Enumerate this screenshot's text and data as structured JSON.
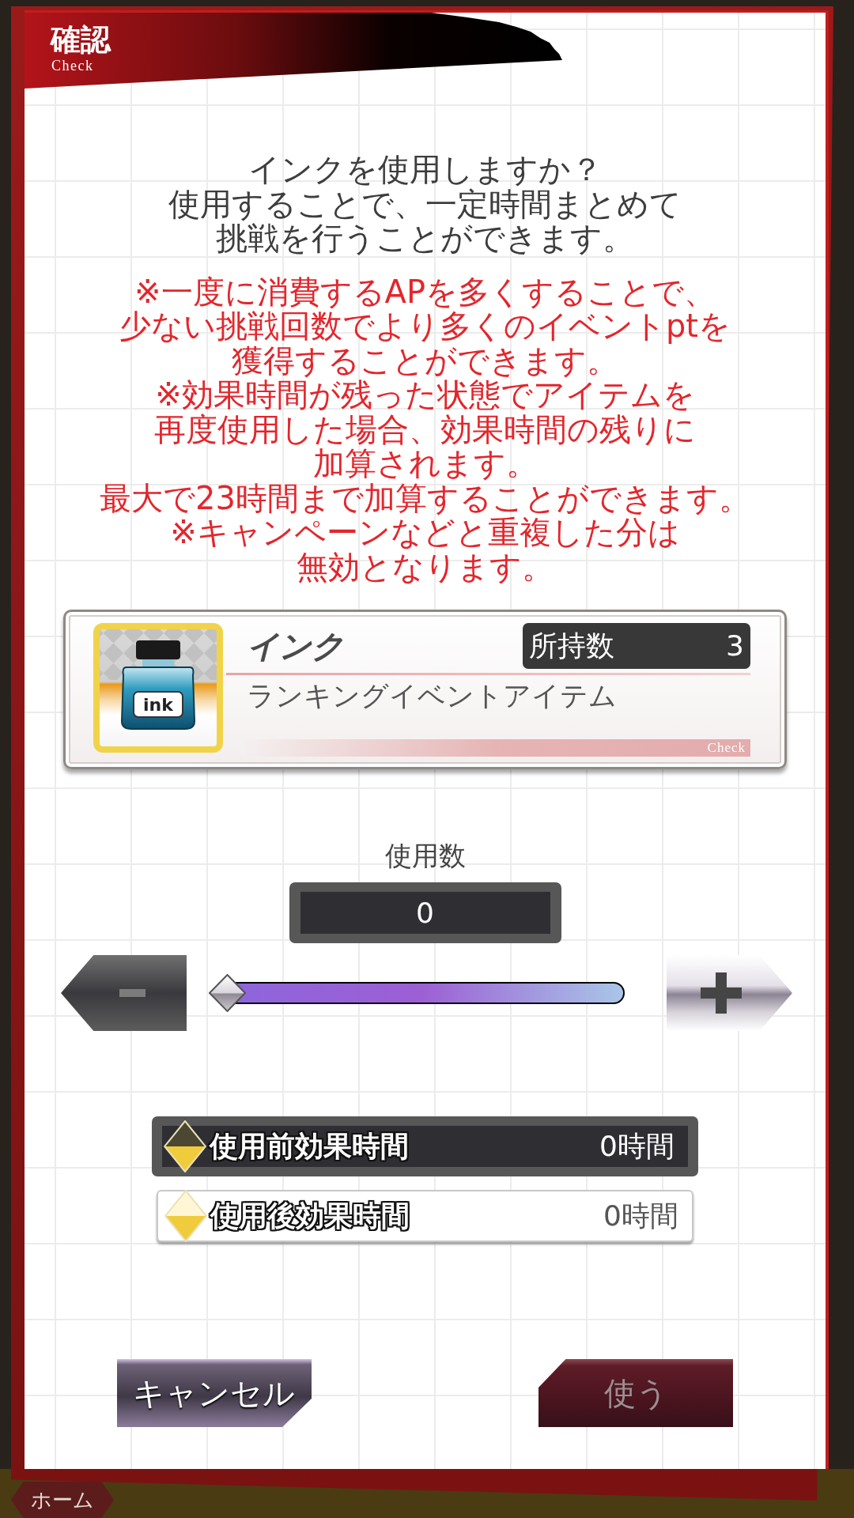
{
  "dialog": {
    "title": "確認",
    "subtitle": "Check",
    "message_lines": [
      "インクを使用しますか？",
      "使用することで、一定時間まとめて",
      "挑戦を行うことができます。"
    ],
    "note_lines": [
      "※一度に消費するAPを多くすることで、",
      "少ない挑戦回数でより多くのイベントptを",
      "獲得することができます。",
      "※効果時間が残った状態でアイテムを",
      "再度使用した場合、効果時間の残りに",
      "加算されます。",
      "最大で23時間まで加算することができます。",
      "※キャンペーンなどと重複した分は",
      "無効となります。"
    ],
    "item": {
      "icon_label": "ink",
      "name": "インク",
      "owned_label": "所持数",
      "owned_count": "3",
      "description": "ランキングイベントアイテム",
      "footer_label": "Check"
    },
    "quantity": {
      "label": "使用数",
      "value": "0",
      "level": 0
    },
    "effect_rows": [
      {
        "kind": "before",
        "label": "使用前効果時間",
        "value": "0時間"
      },
      {
        "kind": "after",
        "label": "使用後効果時間",
        "value": "0時間"
      }
    ],
    "buttons": [
      {
        "kind": "cancel",
        "label": "キャンセル",
        "disabled": false
      },
      {
        "kind": "confirm",
        "label": "使う",
        "disabled": true
      }
    ]
  },
  "nav_bar": {
    "tabs": [
      {
        "label": "ホーム"
      }
    ]
  }
}
